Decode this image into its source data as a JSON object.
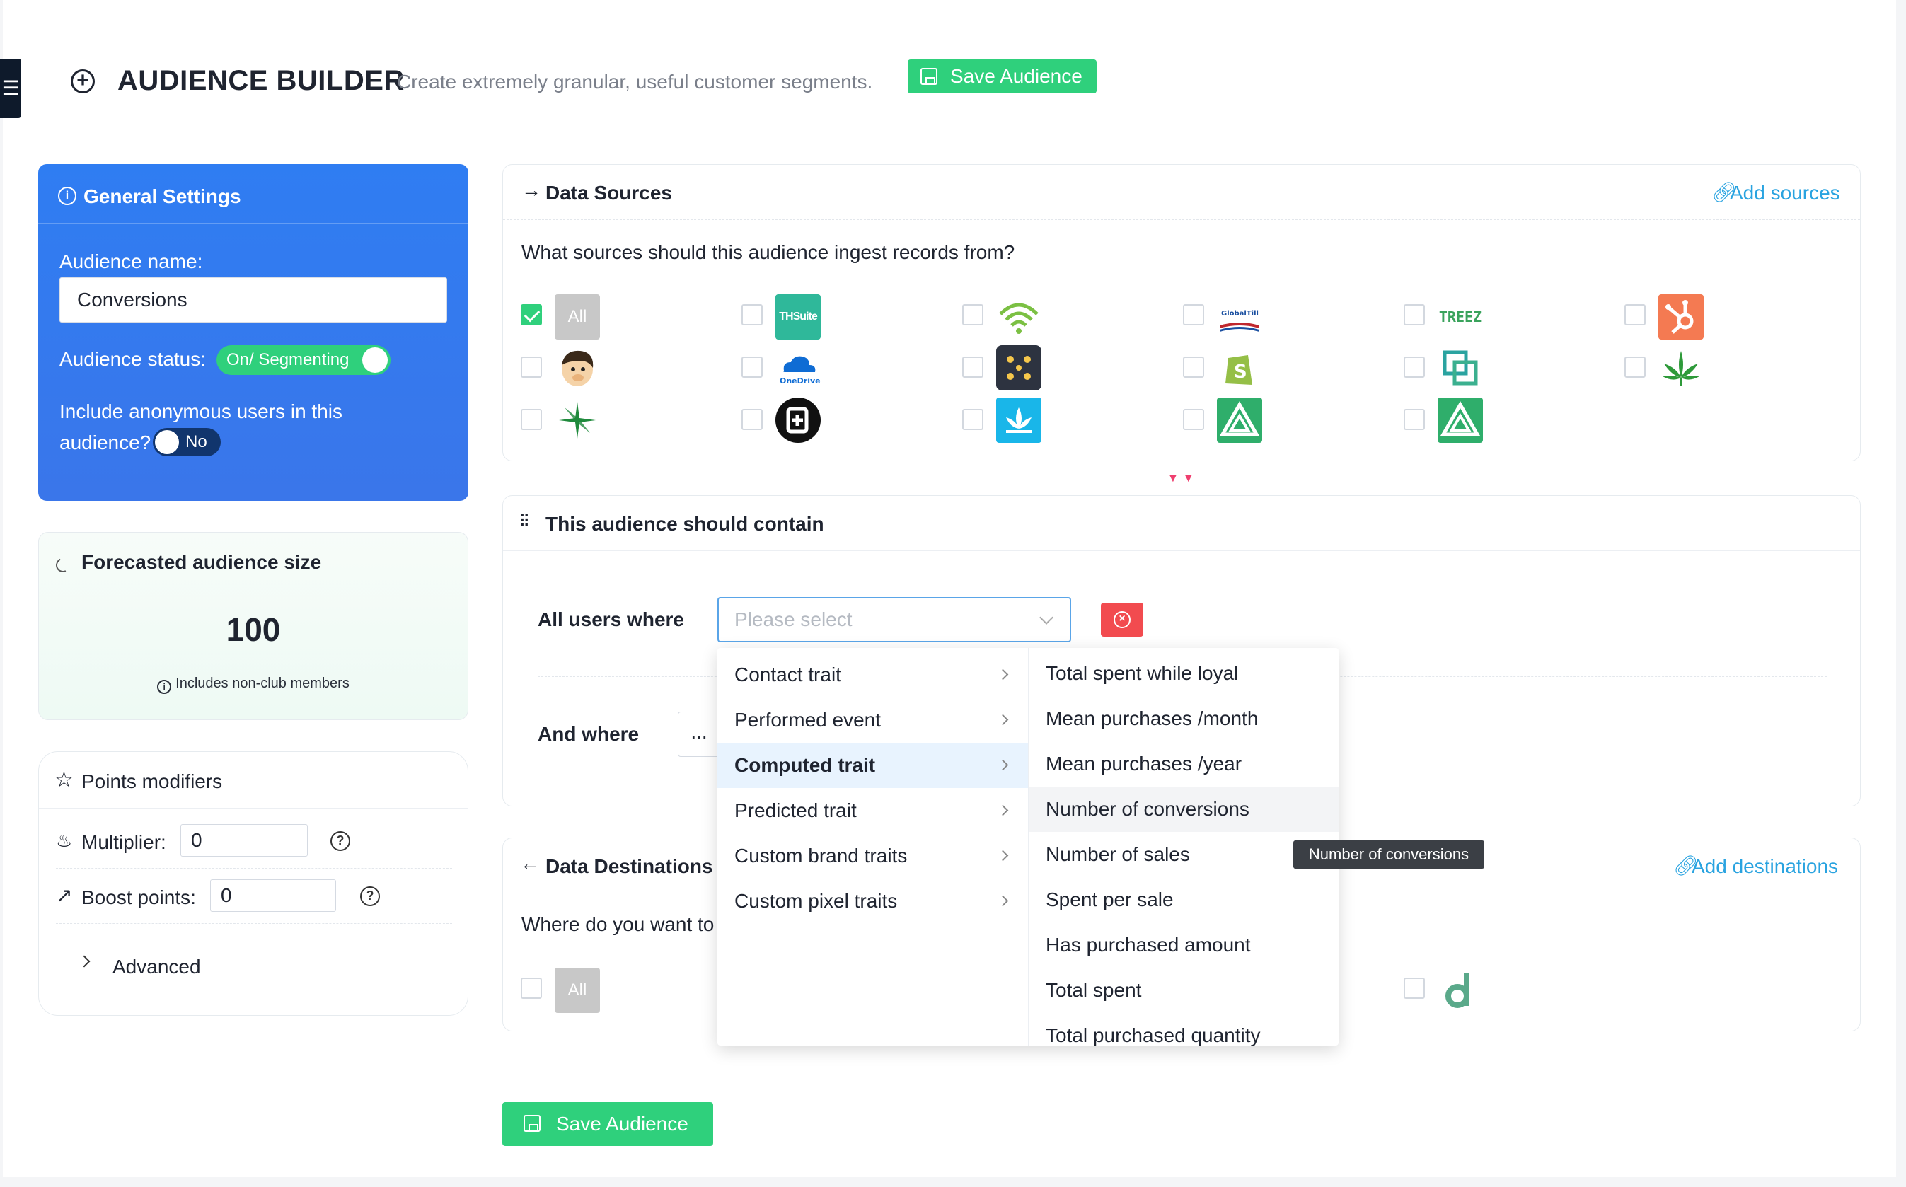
{
  "header": {
    "title": "AUDIENCE BUILDER",
    "subtitle": "Create extremely granular, useful customer segments.",
    "save_label": "Save Audience"
  },
  "general": {
    "title": "General Settings",
    "name_label": "Audience name:",
    "name_value": "Conversions",
    "status_label": "Audience status:",
    "status_value": "On/ Segmenting",
    "anon_label_line1": "Include anonymous users in this",
    "anon_label_line2": "audience?",
    "anon_value": "No"
  },
  "forecast": {
    "title": "Forecasted audience size",
    "value": "100",
    "note": "Includes non-club members"
  },
  "points": {
    "title": "Points modifiers",
    "multiplier_label": "Multiplier:",
    "multiplier_value": "0",
    "boost_label": "Boost points:",
    "boost_value": "0",
    "advanced_label": "Advanced"
  },
  "sources": {
    "title": "Data Sources",
    "add_link": "Add sources",
    "question": "What sources should this audience ingest records from?",
    "all_label": "All",
    "logo_texts": {
      "thsuite": "THSuite",
      "globaltill": "GlobalTill",
      "treez": "TREEZ",
      "onedrive": "OneDrive"
    }
  },
  "contain": {
    "title": "This audience should contain",
    "all_users_where": "All users where",
    "and_where": "And where",
    "and_placeholder": "...",
    "select_placeholder": "Please select"
  },
  "cascader": {
    "level1": [
      {
        "label": "Contact trait"
      },
      {
        "label": "Performed event"
      },
      {
        "label": "Computed trait"
      },
      {
        "label": "Predicted trait"
      },
      {
        "label": "Custom brand traits"
      },
      {
        "label": "Custom pixel traits"
      }
    ],
    "level2": [
      {
        "label": "Total spent while loyal"
      },
      {
        "label": "Mean purchases /month"
      },
      {
        "label": "Mean purchases /year"
      },
      {
        "label": "Number of conversions"
      },
      {
        "label": "Number of sales"
      },
      {
        "label": "Spent per sale"
      },
      {
        "label": "Has purchased amount"
      },
      {
        "label": "Total spent"
      },
      {
        "label": "Total purchased quantity"
      }
    ],
    "tooltip": "Number of conversions"
  },
  "destinations": {
    "title": "Data Destinations",
    "add_link": "Add destinations",
    "question": "Where do you want to",
    "all_label": "All"
  },
  "colors": {
    "primary_blue": "#2f7df2",
    "success_green": "#2fd07c",
    "link_blue": "#29a3e0",
    "danger_red": "#f24b4f"
  }
}
